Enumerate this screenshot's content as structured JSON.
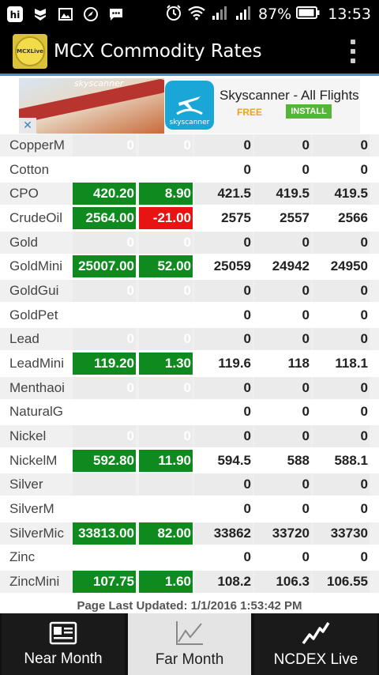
{
  "status_bar": {
    "battery": "87%",
    "time": "13:53",
    "app_badge": "hi"
  },
  "app": {
    "title": "MCX Commodity Rates",
    "logo_text": "MCXLive"
  },
  "ad": {
    "brand_small": "skyscanner",
    "icon_label": "skyscanner",
    "title": "Skyscanner - All Flights",
    "free_label": "FREE",
    "install_label": "INSTALL",
    "close_symbol": "✕"
  },
  "rows": [
    {
      "name": "CopperM",
      "price": "0",
      "change": "0",
      "v1": "0",
      "v2": "0",
      "v3": "0",
      "state": "zero"
    },
    {
      "name": "Cotton",
      "price": "",
      "change": "",
      "v1": "0",
      "v2": "0",
      "v3": "0",
      "state": "blank"
    },
    {
      "name": "CPO",
      "price": "420.20",
      "change": "8.90",
      "v1": "421.5",
      "v2": "419.5",
      "v3": "419.5",
      "state": "pos"
    },
    {
      "name": "CrudeOil",
      "price": "2564.00",
      "change": "-21.00",
      "v1": "2575",
      "v2": "2557",
      "v3": "2566",
      "state": "neg"
    },
    {
      "name": "Gold",
      "price": "0",
      "change": "0",
      "v1": "0",
      "v2": "0",
      "v3": "0",
      "state": "zero"
    },
    {
      "name": "GoldMini",
      "price": "25007.00",
      "change": "52.00",
      "v1": "25059",
      "v2": "24942",
      "v3": "24950",
      "state": "pos"
    },
    {
      "name": "GoldGui",
      "price": "0",
      "change": "0",
      "v1": "0",
      "v2": "0",
      "v3": "0",
      "state": "zero"
    },
    {
      "name": "GoldPet",
      "price": "",
      "change": "",
      "v1": "0",
      "v2": "0",
      "v3": "0",
      "state": "blank"
    },
    {
      "name": "Lead",
      "price": "0",
      "change": "0",
      "v1": "0",
      "v2": "0",
      "v3": "0",
      "state": "zero"
    },
    {
      "name": "LeadMini",
      "price": "119.20",
      "change": "1.30",
      "v1": "119.6",
      "v2": "118",
      "v3": "118.1",
      "state": "pos"
    },
    {
      "name": "Menthaoi",
      "price": "0",
      "change": "0",
      "v1": "0",
      "v2": "0",
      "v3": "0",
      "state": "zero"
    },
    {
      "name": "NaturalG",
      "price": "",
      "change": "",
      "v1": "0",
      "v2": "0",
      "v3": "0",
      "state": "blank"
    },
    {
      "name": "Nickel",
      "price": "0",
      "change": "0",
      "v1": "0",
      "v2": "0",
      "v3": "0",
      "state": "zero"
    },
    {
      "name": "NickelM",
      "price": "592.80",
      "change": "11.90",
      "v1": "594.5",
      "v2": "588",
      "v3": "588.1",
      "state": "pos"
    },
    {
      "name": "Silver",
      "price": "",
      "change": "",
      "v1": "0",
      "v2": "0",
      "v3": "0",
      "state": "blank"
    },
    {
      "name": "SilverM",
      "price": "0",
      "change": "0",
      "v1": "0",
      "v2": "0",
      "v3": "0",
      "state": "zero"
    },
    {
      "name": "SilverMic",
      "price": "33813.00",
      "change": "82.00",
      "v1": "33862",
      "v2": "33720",
      "v3": "33730",
      "state": "pos"
    },
    {
      "name": "Zinc",
      "price": "0",
      "change": "0",
      "v1": "0",
      "v2": "0",
      "v3": "0",
      "state": "zero"
    },
    {
      "name": "ZincMini",
      "price": "107.75",
      "change": "1.60",
      "v1": "108.2",
      "v2": "106.3",
      "v3": "106.55",
      "state": "pos"
    }
  ],
  "footer": {
    "updated": "Page Last Updated: 1/1/2016 1:53:42 PM"
  },
  "nav": {
    "near": "Near Month",
    "far": "Far Month",
    "ncdex": "NCDEX Live",
    "selected": "far"
  },
  "colors": {
    "positive": "#0f8a1e",
    "negative": "#e81414",
    "accent": "#4a8fc8"
  }
}
